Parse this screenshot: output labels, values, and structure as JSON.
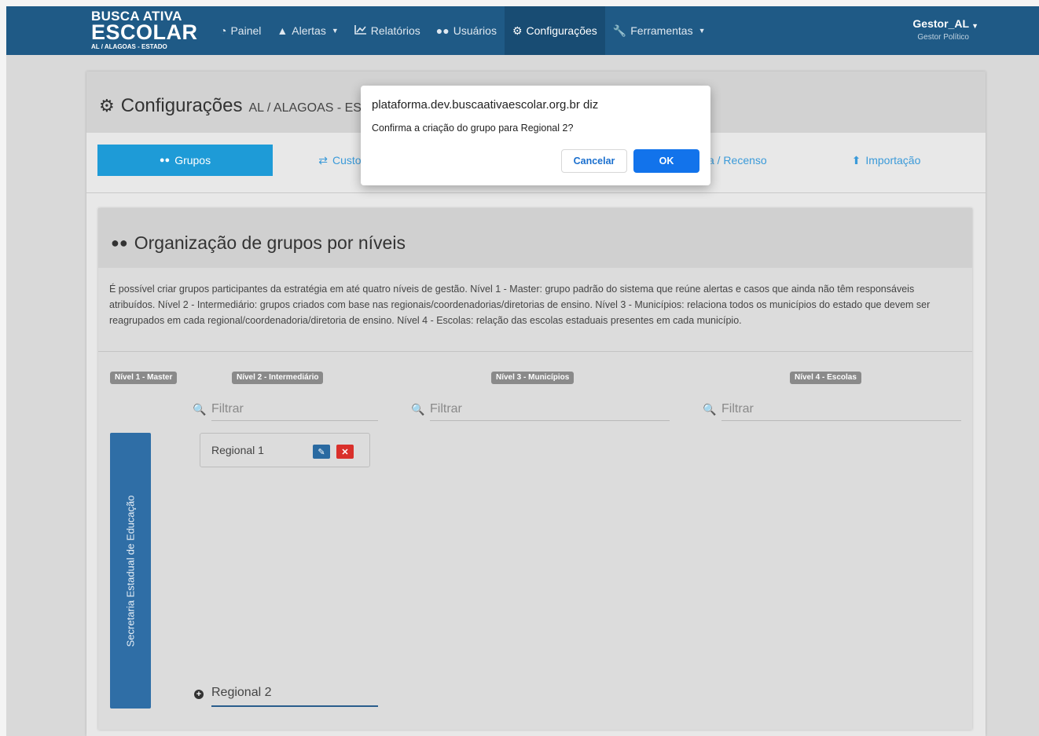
{
  "navbar": {
    "brand_line1": "BUSCA ATIVA",
    "brand_line2": "ESCOLAR",
    "brand_line3": "AL / ALAGOAS - ESTADO",
    "items": [
      {
        "label": "Painel",
        "icon": "dashboard-icon"
      },
      {
        "label": "Alertas",
        "icon": "bell-icon"
      },
      {
        "label": "Relatórios",
        "icon": "chart-icon"
      },
      {
        "label": "Usuários",
        "icon": "users-icon"
      },
      {
        "label": "Configurações",
        "icon": "gear-icon"
      },
      {
        "label": "Ferramentas",
        "icon": "wrench-icon"
      }
    ],
    "user_name": "Gestor_AL",
    "user_role": "Gestor Político",
    "color": "#1f5a86"
  },
  "page": {
    "title": "Configurações",
    "subtitle": "AL / ALAGOAS - ESTADO",
    "tabs": [
      {
        "label": "Grupos",
        "icon": "users-icon",
        "active": true
      },
      {
        "label": "Customização",
        "icon": "shuffle-icon"
      },
      {
        "label": "",
        "icon": ""
      },
      {
        "label": "Rematrícula / Recenso",
        "icon": ""
      },
      {
        "label": "Importação",
        "icon": "upload-icon"
      }
    ]
  },
  "groups": {
    "title": "Organização de grupos por níveis",
    "description": "É possível criar grupos participantes da estratégia em até quatro níveis de gestão. Nível 1 - Master: grupo padrão do sistema que reúne alertas e casos que ainda não têm responsáveis atribuídos. Nível 2 - Intermediário: grupos criados com base nas regionais/coordenadorias/diretorias de ensino. Nível 3 - Municípios: relaciona todos os municípios do estado que devem ser reagrupados em cada regional/coordenadoria/diretoria de ensino. Nível 4 - Escolas: relação das escolas estaduais presentes em cada município.",
    "levels": [
      "Nível 1 - Master",
      "Nível 2 - Intermediário",
      "Nível 3 - Municípios",
      "Nível 4 - Escolas"
    ],
    "filter_placeholder": "Filtrar",
    "master_label": "Secretaria Estadual de Educação",
    "items": [
      {
        "name": "Regional 1"
      }
    ],
    "new_group_value": "Regional 2"
  },
  "dialog": {
    "origin": "plataforma.dev.buscaativaescolar.org.br diz",
    "message": "Confirma a criação do grupo para Regional 2?",
    "cancel_label": "Cancelar",
    "ok_label": "OK"
  }
}
